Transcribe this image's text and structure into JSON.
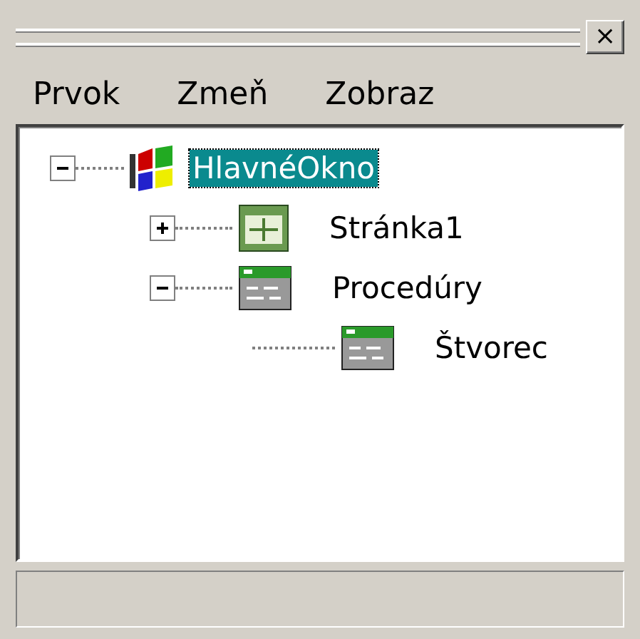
{
  "menu": [
    {
      "label": "Prvok"
    },
    {
      "label": "Zmeň"
    },
    {
      "label": "Zobraz"
    }
  ],
  "close_button": {
    "label": "×"
  },
  "tree": [
    {
      "label": "HlavnéOkno",
      "kind": "window",
      "expanded": true,
      "selected": true,
      "children": [
        {
          "label": "Stránka1",
          "kind": "page",
          "expanded": false,
          "selected": false
        },
        {
          "label": "Procedúry",
          "kind": "form",
          "expanded": true,
          "selected": false,
          "children": [
            {
              "label": "Štvorec",
              "kind": "form",
              "selected": false
            }
          ]
        }
      ]
    }
  ]
}
